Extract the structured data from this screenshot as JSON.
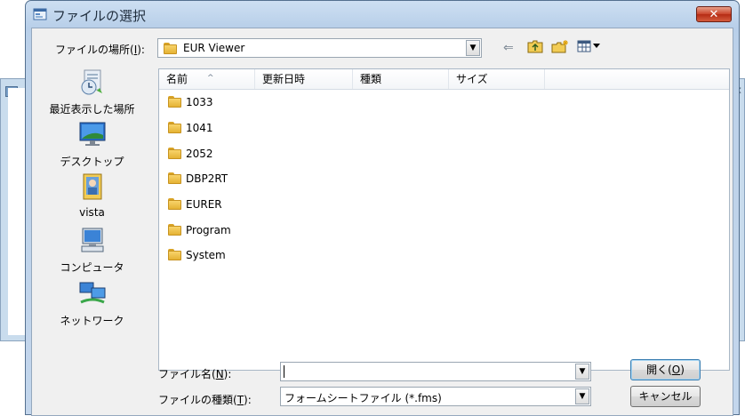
{
  "dialog": {
    "title": "ファイルの選択",
    "close_symbol": "✕"
  },
  "toolbar": {
    "lookin_label": "ファイルの場所(",
    "lookin_key": "I",
    "lookin_label_end": "):",
    "lookin_value": "EUR Viewer",
    "back_glyph": "⇐",
    "dropdown_glyph": "▼"
  },
  "places": [
    {
      "label": "最近表示した場所",
      "icon": "recent-places-icon"
    },
    {
      "label": "デスクトップ",
      "icon": "desktop-icon"
    },
    {
      "label": "vista",
      "icon": "user-folder-icon"
    },
    {
      "label": "コンピュータ",
      "icon": "computer-icon"
    },
    {
      "label": "ネットワーク",
      "icon": "network-icon"
    }
  ],
  "columns": {
    "name": "名前",
    "modified": "更新日時",
    "type": "種類",
    "size": "サイズ",
    "sort_arrow": "^"
  },
  "files": [
    "1033",
    "1041",
    "2052",
    "DBP2RT",
    "EURER",
    "Program",
    "System"
  ],
  "filename": {
    "label": "ファイル名(",
    "key": "N",
    "label_end": "):",
    "value": ""
  },
  "filetype": {
    "label": "ファイルの種類(",
    "key": "T",
    "label_end": "):",
    "value": "フォームシートファイル (*.fms)"
  },
  "buttons": {
    "open_label": "開く(",
    "open_key": "O",
    "open_end": ")",
    "cancel_label": "キャンセル"
  },
  "colors": {
    "titlebar": "#c3d6ec",
    "close_button": "#c9432a",
    "folder": "#f0c34c"
  }
}
